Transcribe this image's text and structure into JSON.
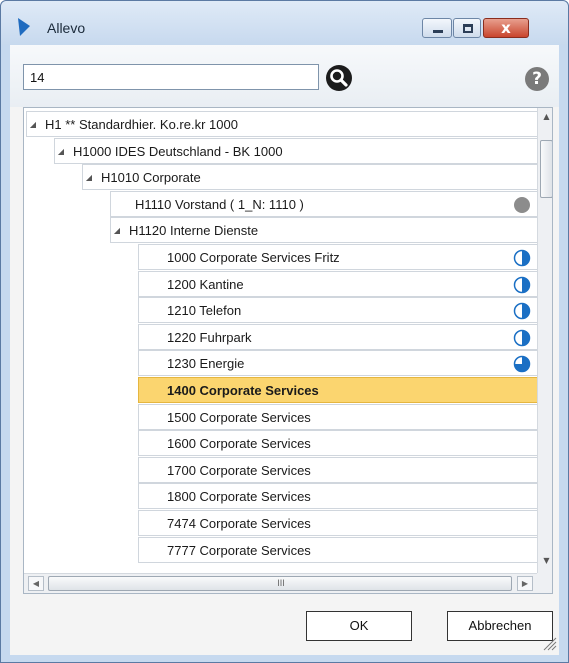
{
  "window": {
    "title": "Allevo",
    "close_glyph": "x",
    "colors": {
      "accent": "#1f6bbf",
      "selection": "#fbd56f",
      "status_grey": "#8c8c8c",
      "status_blue": "#1a6fc4"
    }
  },
  "search": {
    "value": "14",
    "icon": "magnifier-icon",
    "help_label": "?"
  },
  "tree": {
    "expander_glyph": "◢",
    "rows": [
      {
        "label": "H1 ** Standardhier. Ko.re.kr 1000",
        "level": 0,
        "expanded": true
      },
      {
        "label": "H1000 IDES Deutschland - BK 1000",
        "level": 1,
        "expanded": true
      },
      {
        "label": "H1010 Corporate",
        "level": 2,
        "expanded": true
      },
      {
        "label": "H1110 Vorstand ( 1_N: 1110 )",
        "level": 3,
        "status": "grey-dot-icon"
      },
      {
        "label": "H1120 Interne Dienste",
        "level": 3,
        "expanded": true
      },
      {
        "label": "1000 Corporate Services Fritz",
        "level": 4,
        "status": "half-circle-icon"
      },
      {
        "label": "1200 Kantine",
        "level": 4,
        "status": "half-circle-icon"
      },
      {
        "label": "1210 Telefon",
        "level": 4,
        "status": "half-circle-icon"
      },
      {
        "label": "1220 Fuhrpark",
        "level": 4,
        "status": "half-circle-icon"
      },
      {
        "label": "1230 Energie",
        "level": 4,
        "status": "three-quarter-circle-icon"
      },
      {
        "label": "1400 Corporate Services",
        "level": 4,
        "selected": true
      },
      {
        "label": "1500 Corporate Services",
        "level": 4
      },
      {
        "label": "1600 Corporate Services",
        "level": 4
      },
      {
        "label": "1700 Corporate Services",
        "level": 4
      },
      {
        "label": "1800 Corporate Services",
        "level": 4
      },
      {
        "label": "7474 Corporate Services",
        "level": 4
      },
      {
        "label": "7777 Corporate Services",
        "level": 4
      }
    ]
  },
  "scroll": {
    "grip": "III",
    "left_arrow": "◀",
    "right_arrow": "▶",
    "up_arrow": "▲",
    "down_arrow": "▼"
  },
  "buttons": {
    "ok": "OK",
    "cancel": "Abbrechen"
  }
}
